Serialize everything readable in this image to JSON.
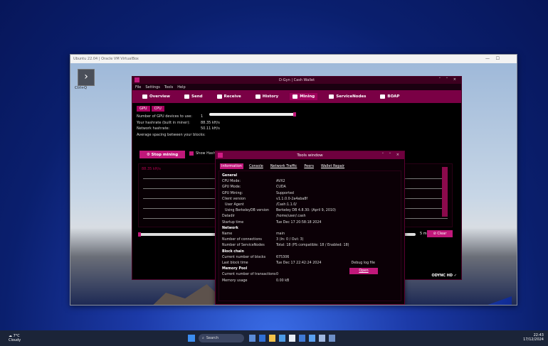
{
  "host": {
    "vm_window_title": "Ubuntu 22.04 | Oracle VM VirtualBox",
    "vm_controls": [
      "—",
      "☐"
    ],
    "guest_icon_label": "Ctrl+Q"
  },
  "app": {
    "title": "D-Gyn | Cash Wallet",
    "window_controls": "˅ ˄ ×",
    "menu": [
      "File",
      "Settings",
      "Tools",
      "Help"
    ],
    "toolbar": [
      "Overview",
      "Send",
      "Receive",
      "History",
      "Mining",
      "ServiceNodes",
      "BOAP"
    ],
    "active_toolbar": "Mining",
    "subtabs": [
      "GPU",
      "CPU"
    ],
    "mining": {
      "rows": [
        {
          "label": "Number of GPU devices to use:",
          "value": "1"
        },
        {
          "label": "Your hashrate (built in miner):",
          "value": "88.35 kH/s"
        },
        {
          "label": "Network hashrate:",
          "value": "50.11 kH/s"
        },
        {
          "label": "Average spacing between your blocks:",
          "value": ""
        }
      ],
      "gpu_devices_fraction": 1.0,
      "stop_button": "Stop mining",
      "show_hash_label": "Show Hash R",
      "graph_label": "88.35 kH/s",
      "time_label": "5 m",
      "clear_button": "Clear"
    },
    "status": "ODYNC HD"
  },
  "tools": {
    "title": "Tools window",
    "window_controls": "˅ ˄ ×",
    "tabs": [
      "Information",
      "Console",
      "Network Traffic",
      "Peers",
      "Wallet Repair"
    ],
    "active_tab": "Information",
    "general_header": "General",
    "general": [
      {
        "k": "CPU Mode:",
        "v": "AVX2",
        "indent": false
      },
      {
        "k": "GPU Mode:",
        "v": "CUDA",
        "indent": false
      },
      {
        "k": "GPU Mining:",
        "v": "Supported",
        "indent": false
      },
      {
        "k": "Client version",
        "v": "v1.1.0.0-2a4aba8f",
        "indent": false
      },
      {
        "k": "User Agent",
        "v": "/Cash:1.1.0/",
        "indent": true
      },
      {
        "k": "Using BerkeleyDB version",
        "v": "Berkeley DB 4.8.30: (April 9, 2010)",
        "indent": true
      },
      {
        "k": "Datadir",
        "v": "/home/user/.cash",
        "indent": false
      },
      {
        "k": "Startup time",
        "v": "Tue Dec 17 20:58:18 2024",
        "indent": false
      }
    ],
    "network_header": "Network",
    "network": [
      {
        "k": "Name",
        "v": "main"
      },
      {
        "k": "Number of connections",
        "v": "3 (In: 0 / Out: 3)"
      },
      {
        "k": "Number of ServiceNodes",
        "v": "Total: 18 (PS compatible: 18 / Enabled: 18)"
      }
    ],
    "blockchain_header": "Block chain",
    "blockchain": [
      {
        "k": "Current number of blocks",
        "v": "675306"
      },
      {
        "k": "Last block time",
        "v": "Tue Dec 17 22:42:24 2024"
      }
    ],
    "mempool_header": "Memory Pool",
    "mempool": [
      {
        "k": "Current number of transactions",
        "v": "0"
      },
      {
        "k": "Memory usage",
        "v": "0.00 kB"
      }
    ],
    "debug_label": "Debug log file",
    "open_button": "Open"
  },
  "taskbar": {
    "weather_temp": "7°C",
    "weather_desc": "Cloudy",
    "search_placeholder": "Search",
    "time": "22:43",
    "date": "17/12/2024"
  }
}
